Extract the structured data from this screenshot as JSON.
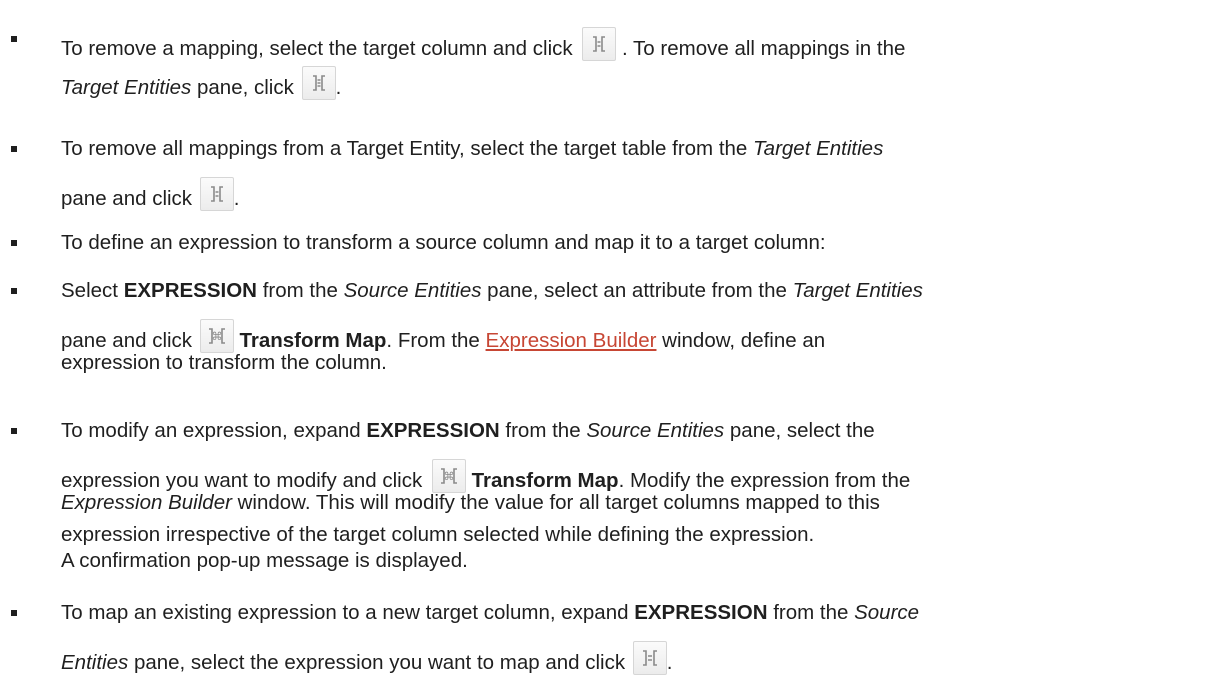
{
  "items": [
    {
      "seg": [
        "To remove a mapping, select the target column and click",
        ". To remove all mappings in the",
        "Target Entities",
        "pane, click",
        "."
      ],
      "icons": [
        "unmap-icon",
        "unmap-all-icon"
      ]
    },
    {
      "seg": [
        "To remove all mappings from a Target Entity, select the target table from the",
        "Target Entities",
        "pane and click",
        "."
      ],
      "icons": [
        "unmap-icon"
      ]
    },
    {
      "seg": [
        "To define an expression to transform a source column and map it to a target column:"
      ]
    },
    {
      "seg": [
        "Select",
        "EXPRESSION",
        "from the",
        "Source Entities",
        "pane, select an attribute from the",
        "Target Entities",
        "pane and click",
        "Transform Map",
        ". From the",
        "Expression Builder",
        "window, define an",
        "expression to transform the column."
      ],
      "icons": [
        "transform-map-icon"
      ]
    },
    {
      "seg": [
        "To modify an expression, expand",
        "EXPRESSION",
        "from the",
        "Source Entities",
        "pane, select the",
        "expression you want to modify and click",
        "Transform Map",
        ". Modify the expression from the",
        "Expression Builder",
        "window. This will modify the value for all target columns mapped to this",
        "expression irrespective of the target column selected while defining the expression.",
        "A confirmation pop-up message is displayed."
      ],
      "icons": [
        "transform-map-icon"
      ]
    },
    {
      "seg": [
        "To map an existing expression to a new target column, expand",
        "EXPRESSION",
        "from the",
        "Source",
        "Entities",
        "pane, select the expression you want to map and click",
        "."
      ],
      "icons": [
        "map-expression-icon"
      ]
    }
  ],
  "colors": {
    "text": "#1f1f1f",
    "link": "#c74634",
    "button_border": "#d6d6d6",
    "icon_stroke": "#8a8a8a"
  }
}
